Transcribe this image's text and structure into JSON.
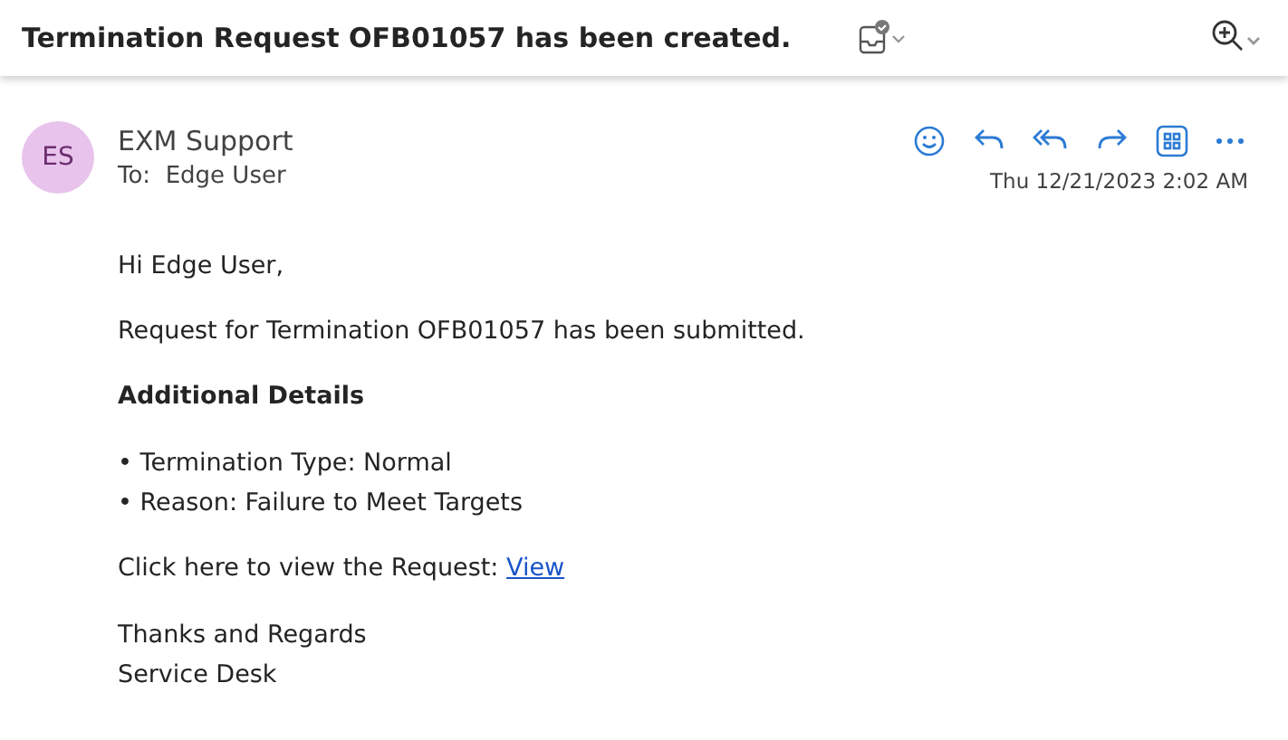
{
  "subject": "Termination Request OFB01057 has been created.",
  "sender": {
    "initials": "ES",
    "name": "EXM Support",
    "to_label": "To:",
    "to": "Edge User",
    "date": "Thu 12/21/2023 2:02 AM"
  },
  "body": [
    {
      "kind": "para",
      "text": "Hi Edge User,"
    },
    {
      "kind": "para",
      "text": "Request for Termination OFB01057 has been submitted."
    },
    {
      "kind": "heading",
      "text": "Additional Details"
    },
    {
      "kind": "list",
      "items": [
        "• Termination Type: Normal",
        "• Reason: Failure to Meet Targets"
      ]
    },
    {
      "kind": "link_para",
      "text": "Click here to view the Request:",
      "link": "View"
    },
    {
      "kind": "list",
      "items": [
        "Thanks and Regards",
        "Service Desk"
      ]
    }
  ]
}
